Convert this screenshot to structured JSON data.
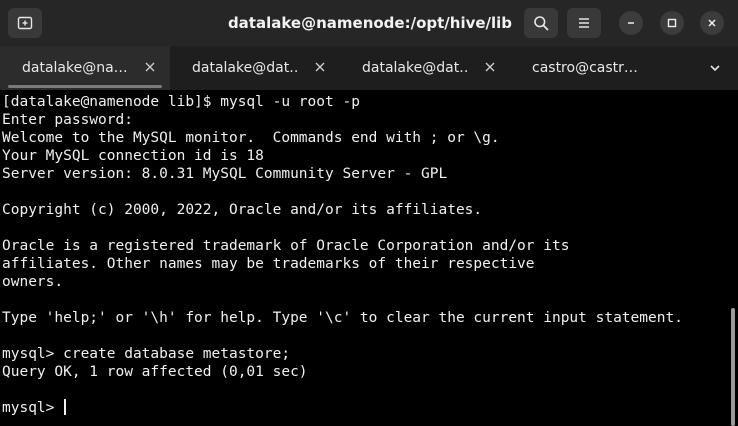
{
  "window": {
    "title": "datalake@namenode:/opt/hive/lib"
  },
  "titlebar": {
    "new_tab_icon": "new-tab-icon",
    "search_icon": "search-icon",
    "menu_icon": "hamburger-menu-icon"
  },
  "tabs": [
    {
      "label": "datalake@na…",
      "active": true
    },
    {
      "label": "datalake@dat…",
      "active": false
    },
    {
      "label": "datalake@dat…",
      "active": false
    },
    {
      "label": "castro@castr…",
      "active": false
    }
  ],
  "terminal": {
    "lines": [
      "[datalake@namenode lib]$ mysql -u root -p",
      "Enter password:",
      "Welcome to the MySQL monitor.  Commands end with ; or \\g.",
      "Your MySQL connection id is 18",
      "Server version: 8.0.31 MySQL Community Server - GPL",
      "",
      "Copyright (c) 2000, 2022, Oracle and/or its affiliates.",
      "",
      "Oracle is a registered trademark of Oracle Corporation and/or its",
      "affiliates. Other names may be trademarks of their respective",
      "owners.",
      "",
      "Type 'help;' or '\\h' for help. Type '\\c' to clear the current input statement.",
      "",
      "mysql> create database metastore;",
      "Query OK, 1 row affected (0,01 sec)",
      ""
    ],
    "prompt": "mysql> "
  },
  "colors": {
    "titlebar_bg": "#262626",
    "tabbar_bg": "#1e1e1e",
    "active_tab_bg": "#2c2c2c",
    "terminal_bg": "#000000",
    "terminal_fg": "#f0f0f0"
  }
}
